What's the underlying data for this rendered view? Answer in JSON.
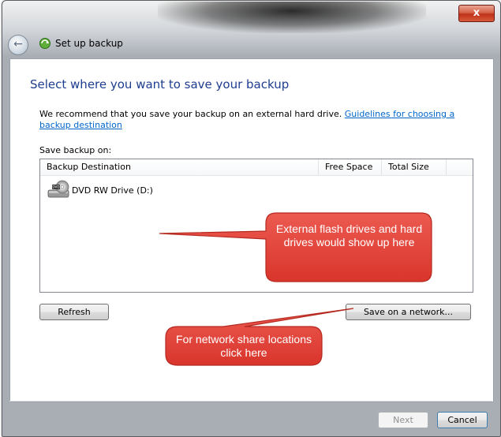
{
  "window": {
    "close_glyph": "x",
    "title": "Set up backup"
  },
  "page": {
    "heading": "Select where you want to save your backup",
    "intro_text": "We recommend that you save your backup on an external hard drive. ",
    "intro_link": "Guidelines for choosing a backup destination",
    "save_on_label": "Save backup on:"
  },
  "destination_list": {
    "columns": [
      "Backup Destination",
      "Free Space",
      "Total Size"
    ],
    "rows": [
      {
        "name": "DVD RW Drive (D:)",
        "free_space": "",
        "total_size": "",
        "icon": "dvd-drive-icon"
      }
    ]
  },
  "buttons": {
    "refresh": "Refresh",
    "save_on_network": "Save on a network...",
    "next": "Next",
    "cancel": "Cancel"
  },
  "callouts": {
    "external": "External flash drives and hard drives would show up here",
    "network": "For network share locations click here",
    "fill_color": "#e8453c",
    "stroke_color": "#c0302a"
  }
}
